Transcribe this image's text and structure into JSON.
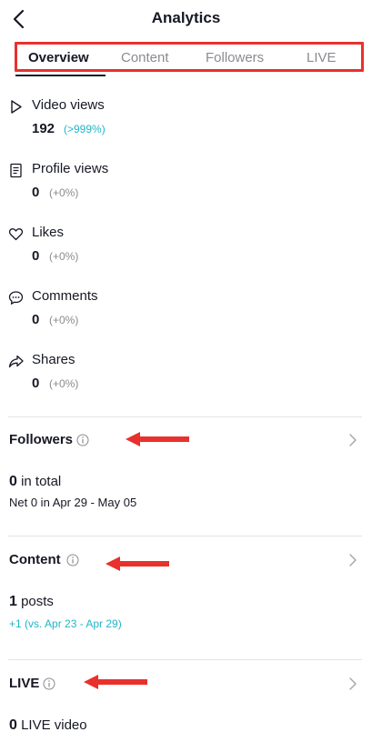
{
  "header": {
    "title": "Analytics"
  },
  "tabs": [
    {
      "label": "Overview"
    },
    {
      "label": "Content"
    },
    {
      "label": "Followers"
    },
    {
      "label": "LIVE"
    }
  ],
  "metrics": [
    {
      "label": "Video views",
      "value": "192",
      "change": "(>999%)",
      "icon": "play-icon"
    },
    {
      "label": "Profile views",
      "value": "0",
      "change": "(+0%)",
      "icon": "profile-document-icon"
    },
    {
      "label": "Likes",
      "value": "0",
      "change": "(+0%)",
      "icon": "heart-icon"
    },
    {
      "label": "Comments",
      "value": "0",
      "change": "(+0%)",
      "icon": "comment-icon"
    },
    {
      "label": "Shares",
      "value": "0",
      "change": "(+0%)",
      "icon": "share-icon"
    }
  ],
  "followers": {
    "title": "Followers",
    "total_value": "0",
    "total_text": " in total",
    "sub": "Net 0 in Apr 29 - May 05"
  },
  "content": {
    "title": "Content",
    "total_value": "1",
    "total_text": " posts",
    "sub": "+1 (vs. Apr 23 - Apr 29)"
  },
  "live": {
    "title": "LIVE",
    "total_value": "0",
    "total_text": " LIVE video"
  },
  "colors": {
    "highlight_red": "#e8312d",
    "accent_teal": "#20b6c8",
    "text": "#161823",
    "muted": "#8a8b91"
  }
}
